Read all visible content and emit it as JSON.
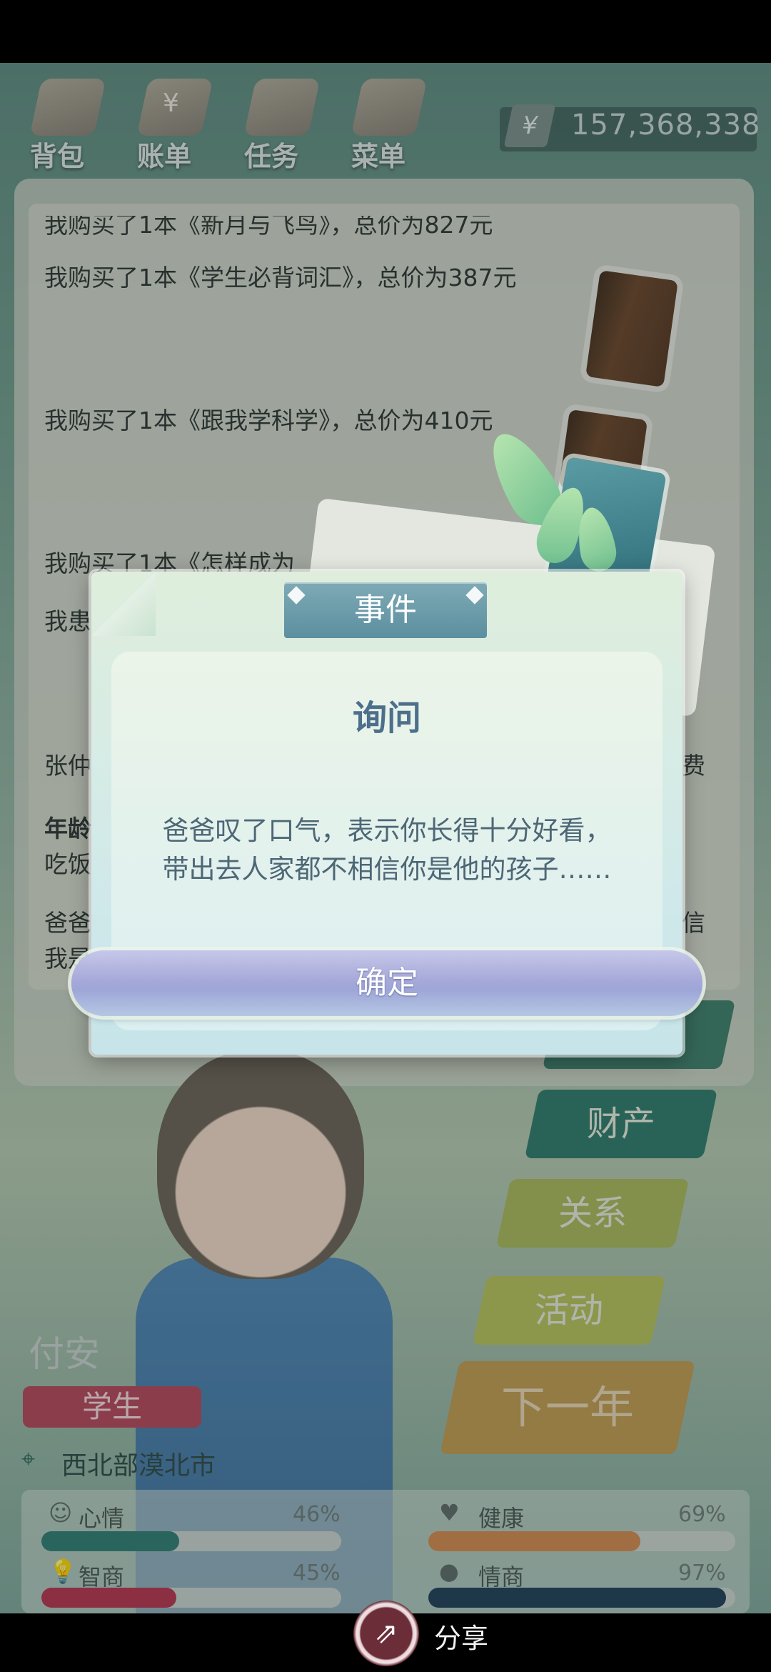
{
  "top_nav": {
    "items": [
      {
        "label": "背包",
        "icon": "bag-icon"
      },
      {
        "label": "账单",
        "icon": "bill-icon"
      },
      {
        "label": "任务",
        "icon": "task-icon"
      },
      {
        "label": "菜单",
        "icon": "menu-icon"
      }
    ],
    "currency_symbol": "¥",
    "money": "157,368,338"
  },
  "log": {
    "lines": [
      "我购买了1本《新月与飞鸟》，总价为827元",
      "我购买了1本《学生必背词汇》，总价为387元",
      "我购买了1本《跟我学科学》，总价为410元",
      "我购买了1本《怎样成为",
      "我患",
      "张仲",
      "费",
      "年龄",
      "吃饭",
      "爸爸",
      "信",
      "我是"
    ]
  },
  "side_buttons": {
    "property": "财产",
    "relation": "关系",
    "activity": "活动",
    "next_year": "下一年"
  },
  "character": {
    "name": "付安",
    "role": "学生",
    "location": "西北部漠北市"
  },
  "stats": {
    "mood": {
      "label": "心情",
      "pct": "46%",
      "value": 0.46,
      "color": "#2e7d72"
    },
    "health": {
      "label": "健康",
      "pct": "69%",
      "value": 0.69,
      "color": "#d58a4e"
    },
    "iq": {
      "label": "智商",
      "pct": "45%",
      "value": 0.45,
      "color": "#b8324e"
    },
    "eq": {
      "label": "情商",
      "pct": "97%",
      "value": 0.97,
      "color": "#1f3f58"
    }
  },
  "modal": {
    "tab_label": "事件",
    "title": "询问",
    "message_line1": "爸爸叹了口气，表示你长得十分好看，",
    "message_line2": "带出去人家都不相信你是他的孩子……",
    "confirm_label": "确定"
  },
  "bottom_bar": {
    "share_label": "分享"
  }
}
